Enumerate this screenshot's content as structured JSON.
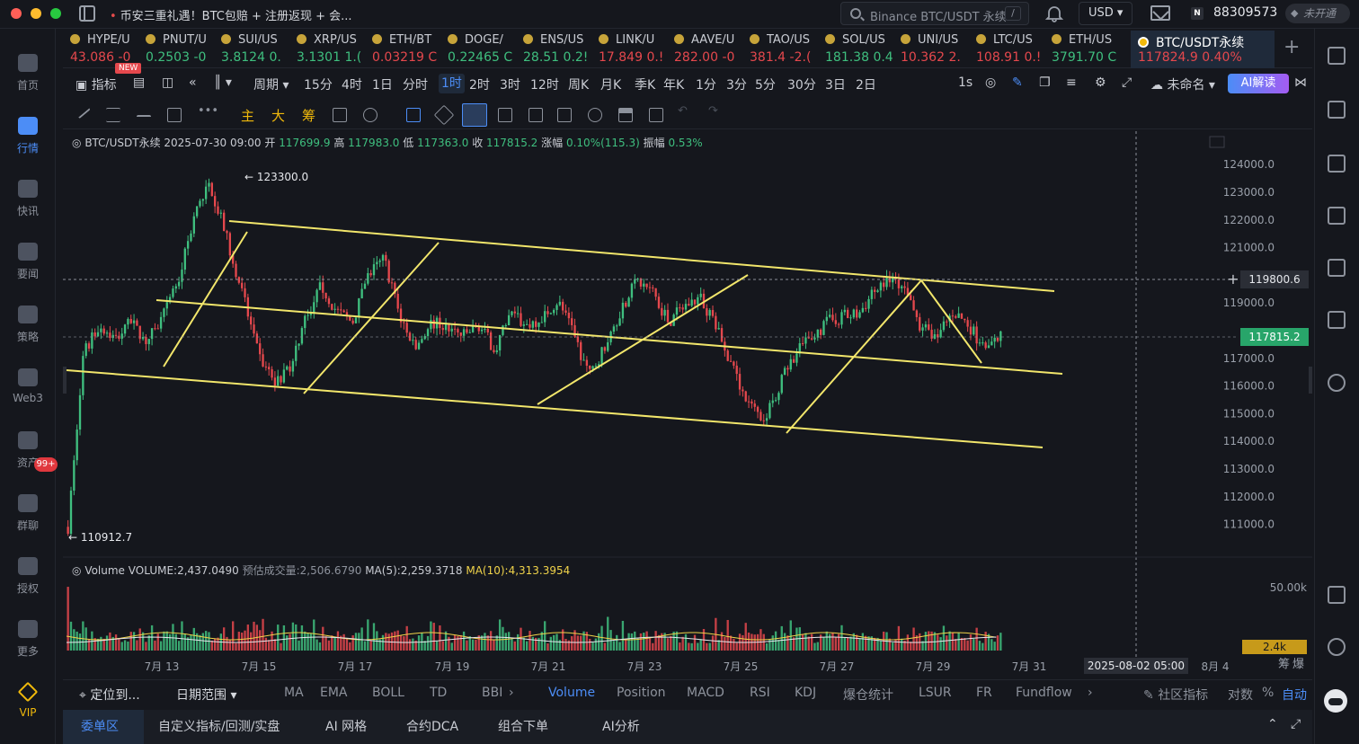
{
  "titlebar": {
    "promo": "币安三重礼遇！BTC包赔 + 注册返现 + 会...",
    "search_placeholder": "Binance BTC/USDT 永续",
    "search_shortcut": "/",
    "currency": "USD",
    "user_id": "88309573",
    "uid_badge": "N",
    "account_status": "未开通"
  },
  "left_nav": [
    {
      "label": "首页",
      "icon": "home-icon"
    },
    {
      "label": "行情",
      "icon": "market-chart-icon",
      "active": true
    },
    {
      "label": "快讯",
      "icon": "flash-news-icon"
    },
    {
      "label": "要闻",
      "icon": "news-icon"
    },
    {
      "label": "策略",
      "icon": "robot-icon"
    },
    {
      "label": "Web3",
      "icon": "web3-icon"
    },
    {
      "label": "资产",
      "icon": "wallet-icon"
    },
    {
      "label": "群聊",
      "icon": "chat-icon",
      "badge": "99+"
    },
    {
      "label": "授权",
      "icon": "authorize-icon"
    },
    {
      "label": "更多",
      "icon": "more-grid-icon"
    },
    {
      "label": "VIP",
      "icon": "vip-diamond-icon"
    }
  ],
  "tickers": [
    {
      "name": "HYPE/U",
      "price": "43.086",
      "change": "-0",
      "dir": "dn",
      "new_badge": "NEW"
    },
    {
      "name": "PNUT/U",
      "price": "0.2503",
      "change": "-0",
      "dir": "up"
    },
    {
      "name": "SUI/US",
      "price": "3.8124",
      "change": "0.",
      "dir": "up"
    },
    {
      "name": "XRP/US",
      "price": "3.1301",
      "change": "1.(",
      "dir": "up"
    },
    {
      "name": "ETH/BT",
      "price": "0.03219",
      "change": "C",
      "dir": "dn"
    },
    {
      "name": "DOGE/",
      "price": "0.22465",
      "change": "C",
      "dir": "up"
    },
    {
      "name": "ENS/US",
      "price": "28.51",
      "change": "0.2!",
      "dir": "up"
    },
    {
      "name": "LINK/U",
      "price": "17.849",
      "change": "0.!",
      "dir": "dn"
    },
    {
      "name": "AAVE/U",
      "price": "282.00",
      "change": "-0",
      "dir": "dn"
    },
    {
      "name": "TAO/US",
      "price": "381.4",
      "change": "-2.(",
      "dir": "dn"
    },
    {
      "name": "SOL/US",
      "price": "181.38",
      "change": "0.4",
      "dir": "up"
    },
    {
      "name": "UNI/US",
      "price": "10.362",
      "change": "2.",
      "dir": "dn"
    },
    {
      "name": "LTC/US",
      "price": "108.91",
      "change": "0.!",
      "dir": "dn"
    },
    {
      "name": "ETH/US",
      "price": "3791.70",
      "change": "C",
      "dir": "up"
    }
  ],
  "active_ticker": {
    "name": "BTC/USDT永续",
    "price": "117824.9",
    "change": "0.40%"
  },
  "period_bar": {
    "indicator": "指标",
    "period": "周期",
    "periods": [
      "15分",
      "4时",
      "1日",
      "分时",
      "1时",
      "2时",
      "3时",
      "12时",
      "周K",
      "月K",
      "季K",
      "年K",
      "1分",
      "3分",
      "5分",
      "30分",
      "3日",
      "2日"
    ],
    "selected_period": "1时",
    "resolution": "1s",
    "layout_name": "未命名",
    "ai_button": "AI解读"
  },
  "draw_tools": {
    "main": "主",
    "big": "大",
    "chips": "筹"
  },
  "ohlc": {
    "symbol": "BTC/USDT永续",
    "datetime": "2025-07-30 09:00",
    "open_label": "开",
    "open": "117699.9",
    "high_label": "高",
    "high": "117983.0",
    "low_label": "低",
    "low": "117363.0",
    "close_label": "收",
    "close": "117815.2",
    "change_label": "涨幅",
    "change": "0.10%(115.3)",
    "amplitude_label": "振幅",
    "amplitude": "0.53%"
  },
  "volume_legend": {
    "name": "Volume",
    "volume": "VOLUME:2,437.0490",
    "est": "预估成交量:2,506.6790",
    "ma5": "MA(5):2,259.3718",
    "ma10": "MA(10):4,313.3954"
  },
  "chart_data": {
    "type": "candlestick",
    "symbol": "BTC/USDT永续",
    "interval": "1时",
    "y_ticks": [
      "124000.0",
      "123000.0",
      "122000.0",
      "121000.0",
      "119000.0",
      "117000.0",
      "116000.0",
      "115000.0",
      "114000.0",
      "113000.0",
      "112000.0",
      "111000.0"
    ],
    "ylim": [
      110500,
      124300
    ],
    "x_ticks": [
      "7月 13",
      "7月 15",
      "7月 17",
      "7月 19",
      "7月 21",
      "7月 23",
      "7月 25",
      "7月 27",
      "7月 29",
      "7月 31",
      "8月 4"
    ],
    "cursor_time": "2025-08-02 05:00",
    "crosshair_price": "119800.6",
    "last_price": "117815.2",
    "high_marker": "123300.0",
    "low_marker": "110912.7",
    "close_series_approx": [
      110912.7,
      117200,
      118200,
      117700,
      118300,
      117600,
      118500,
      119800,
      122200,
      123300,
      121400,
      119400,
      117200,
      116100,
      116700,
      118400,
      119600,
      118700,
      118300,
      120000,
      120600,
      118500,
      117400,
      118300,
      118100,
      117800,
      118200,
      117300,
      118600,
      118200,
      118500,
      119100,
      117800,
      116400,
      117500,
      118800,
      119800,
      119400,
      118300,
      118900,
      119200,
      118100,
      116700,
      115400,
      114800,
      116000,
      117200,
      117700,
      118300,
      118500,
      118600,
      119400,
      119900,
      119300,
      118100,
      117800,
      118700,
      118200,
      117300,
      117815.2
    ],
    "volume_axis": "50.00k",
    "volume_last": "2.4k",
    "trend_lines": "yellow channel and swing lines",
    "extra_labels": [
      "筹",
      "爆"
    ]
  },
  "indicator_bar": {
    "locate": "定位到...",
    "date_range": "日期范围",
    "main_indicators": [
      "MA",
      "EMA",
      "BOLL",
      "TD",
      "BBI"
    ],
    "sub_indicators": [
      "Volume",
      "Position",
      "MACD",
      "RSI",
      "KDJ",
      "爆仓统计",
      "LSUR",
      "FR",
      "Fundflow"
    ],
    "selected_sub": "Volume",
    "community": "社区指标",
    "log": "对数",
    "percent": "%",
    "auto": "自动"
  },
  "bottom_tabs": [
    "委单区",
    "自定义指标/回测/实盘",
    "AI 网格",
    "合约DCA",
    "组合下单",
    "AI分析"
  ],
  "colors": {
    "up": "#3fbf7f",
    "down": "#e5484d",
    "accent": "#4c8df6",
    "trendline": "#f2e66b",
    "brand": "#f0b90b"
  }
}
